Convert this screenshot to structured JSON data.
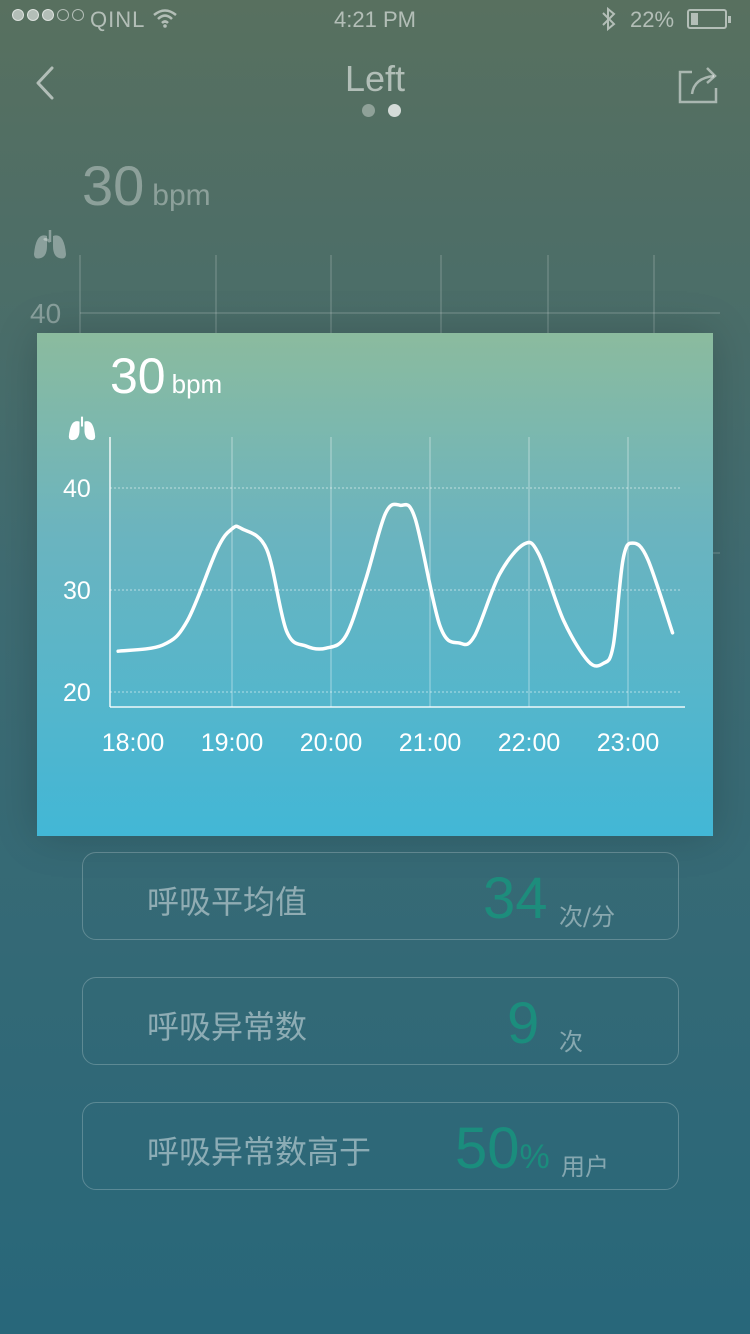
{
  "status_bar": {
    "carrier": "QINL",
    "time": "4:21 PM",
    "battery": "22%",
    "battery_level": 0.22
  },
  "nav": {
    "title": "Left",
    "page_count": 2,
    "active_page": 2
  },
  "background_reading": {
    "value": "30",
    "unit": "bpm",
    "axis_label": "40"
  },
  "popup": {
    "reading": {
      "value": "30",
      "unit": "bpm"
    },
    "icon": "lungs-icon"
  },
  "chart_data": {
    "type": "line",
    "x": [
      "18:00",
      "19:00",
      "20:00",
      "21:00",
      "22:00",
      "23:00"
    ],
    "y_ticks": [
      "40",
      "30",
      "20"
    ],
    "ylim": [
      20,
      40
    ],
    "grid": true,
    "series": [
      {
        "color": "#ffffff",
        "points": [
          [
            17.85,
            24
          ],
          [
            18.3,
            24.6
          ],
          [
            18.55,
            27
          ],
          [
            18.85,
            34
          ],
          [
            19.0,
            36
          ],
          [
            19.1,
            36
          ],
          [
            19.35,
            34
          ],
          [
            19.55,
            26
          ],
          [
            19.75,
            24.5
          ],
          [
            19.95,
            24.3
          ],
          [
            20.15,
            25.5
          ],
          [
            20.35,
            31
          ],
          [
            20.55,
            37.5
          ],
          [
            20.7,
            38.3
          ],
          [
            20.85,
            37
          ],
          [
            21.1,
            26.5
          ],
          [
            21.3,
            24.8
          ],
          [
            21.45,
            25.5
          ],
          [
            21.7,
            31.5
          ],
          [
            21.95,
            34.5
          ],
          [
            22.1,
            33.5
          ],
          [
            22.35,
            27
          ],
          [
            22.6,
            23
          ],
          [
            22.75,
            22.8
          ],
          [
            22.85,
            24.5
          ],
          [
            22.95,
            33
          ],
          [
            23.05,
            34.6
          ],
          [
            23.2,
            33
          ],
          [
            23.45,
            25.8
          ]
        ]
      }
    ]
  },
  "stats": [
    {
      "label": "呼吸平均值",
      "value": "34",
      "unit": "次/分"
    },
    {
      "label": "呼吸异常数",
      "value": "9",
      "unit": "次"
    },
    {
      "label": "呼吸异常数高于",
      "value": "50",
      "suffix": "%",
      "unit": "用户"
    }
  ],
  "colors": {
    "accent": "#139d80",
    "popup_top": "#8bbb9e",
    "popup_bottom": "#42b7d6"
  }
}
